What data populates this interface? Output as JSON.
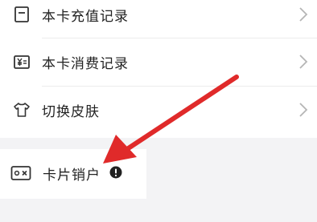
{
  "menu": {
    "items": [
      {
        "label": "本卡充值记录",
        "icon": "card-recharge-icon"
      },
      {
        "label": "本卡消费记录",
        "icon": "yen-receipt-icon"
      },
      {
        "label": "切换皮肤",
        "icon": "shirt-icon"
      }
    ]
  },
  "cancel_section": {
    "label": "卡片销户",
    "icon": "card-close-icon",
    "badge_icon": "exclamation-icon"
  },
  "annotation": {
    "arrow_color": "#e53935"
  }
}
